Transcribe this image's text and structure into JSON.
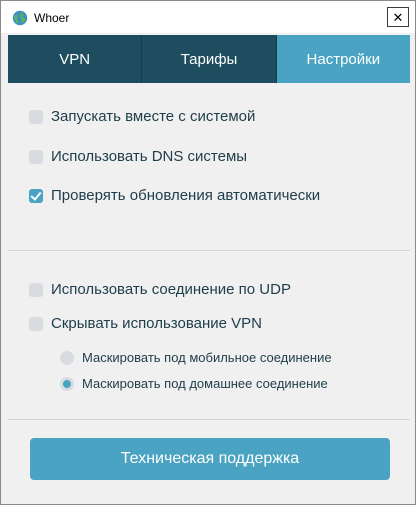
{
  "window": {
    "title": "Whoer",
    "app_icon": "globe-icon",
    "close_icon": "close-icon",
    "close_glyph": "✕"
  },
  "tabs": [
    {
      "label": "VPN",
      "active": false
    },
    {
      "label": "Тарифы",
      "active": false
    },
    {
      "label": "Настройки",
      "active": true
    }
  ],
  "settings": {
    "general": [
      {
        "label": "Запускать вместе с системой",
        "checked": false
      },
      {
        "label": "Использовать DNS системы",
        "checked": false
      },
      {
        "label": "Проверять обновления автоматически",
        "checked": true
      }
    ],
    "connection": [
      {
        "label": "Использовать соединение по UDP",
        "checked": false
      },
      {
        "label": "Скрывать использование VPN",
        "checked": false
      }
    ],
    "masking": [
      {
        "label": "Маскировать под мобильное соединение",
        "selected": false
      },
      {
        "label": "Маскировать под домашнее соединение",
        "selected": true
      }
    ]
  },
  "support_button": "Техническая поддержка",
  "colors": {
    "tab_inactive": "#1f4d60",
    "accent": "#4aa3c2",
    "text": "#1e3d4a",
    "panel_bg": "#f0f0f0"
  }
}
